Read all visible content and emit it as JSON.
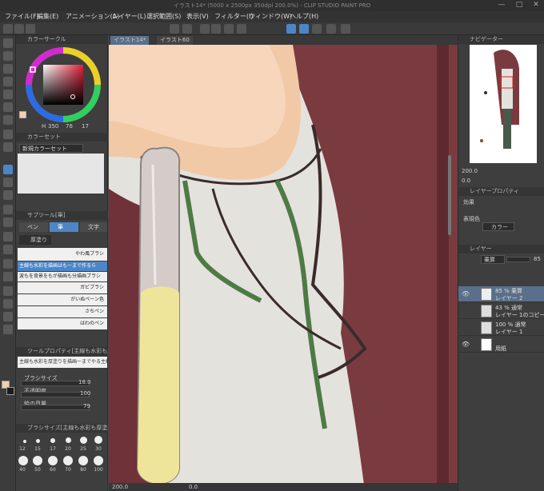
{
  "window": {
    "title": "イラスト14* (5000 x 2500px 350dpi 200.0%) - CLIP STUDIO PAINT PRO",
    "minimize": "—",
    "maximize": "□",
    "close": "✕"
  },
  "menu": [
    "ファイル(F)",
    "編集(E)",
    "アニメーション(A)",
    "レイヤー(L)",
    "選択範囲(S)",
    "表示(V)",
    "フィルター(I)",
    "ウィンドウ(W)",
    "ヘルプ(H)"
  ],
  "tabs": [
    "イラスト14*",
    "イラスト60"
  ],
  "color_circle": {
    "header": "カラーサークル",
    "h": "350",
    "s": "76",
    "v": "17",
    "h_icon": "H"
  },
  "color_set": {
    "header": "カラーセット",
    "preset": "新規カラーセット"
  },
  "subtool": {
    "header": "サブツール[筆]",
    "tabs": [
      "ペン",
      "筆",
      "文字"
    ],
    "active_tab": "筆",
    "group": "厚塗り",
    "brushes": [
      "やわ風ブラシ",
      "主線も水彩を描画はもーまで作るら",
      "波もを背景をもが描画も分描画ブラシ",
      "ガビブラシ",
      "がいぬペーン色",
      "さちペン",
      "はわのペン"
    ]
  },
  "tool_property": {
    "header": "ツールプロパティ[主線も水彩も厚塗り]",
    "preview": "主線も水彩を厚塗りを描画ーまでやる主線ものブラシ",
    "brush_size_label": "ブラシサイズ",
    "brush_size": "18.0",
    "opacity_label": "不透明度",
    "opacity": "100",
    "blend_label": "絵の具量",
    "blend": "79"
  },
  "brush_size_panel": {
    "header": "ブラシサイズ[主線も水彩も厚塗り]",
    "sizes": [
      "12",
      "15",
      "17",
      "20",
      "25",
      "30",
      "40",
      "50",
      "60",
      "70",
      "80",
      "100"
    ]
  },
  "navigator": {
    "header": "ナビゲーター",
    "zoom": "200.0",
    "angle": "0.0"
  },
  "layer_property": {
    "header": "レイヤープロパティ",
    "effect_label": "効果",
    "expression_label": "表現色",
    "expression_value": "カラー"
  },
  "layers": {
    "header": "レイヤー",
    "blend_mode": "乗算",
    "opacity": "85",
    "items": [
      {
        "line1": "85 % 乗算",
        "line2": "レイヤー 2",
        "selected": true,
        "visible": true
      },
      {
        "line1": "43 % 通常",
        "line2": "レイヤー 1のコピー",
        "selected": false,
        "visible": false
      },
      {
        "line1": "100 % 通常",
        "line2": "レイヤー 1",
        "selected": false,
        "visible": false
      },
      {
        "line1": "",
        "line2": "用紙",
        "selected": false,
        "visible": true
      }
    ]
  },
  "statusbar": {
    "zoom": "200.0",
    "angle": "0.0"
  },
  "colors": {
    "accent": "#4c86c6",
    "skin": "#f2c9a6",
    "shirt": "#e4e2dc",
    "hair": "#7a3b40",
    "green": "#4d7a45",
    "yellow": "#efe59a"
  }
}
